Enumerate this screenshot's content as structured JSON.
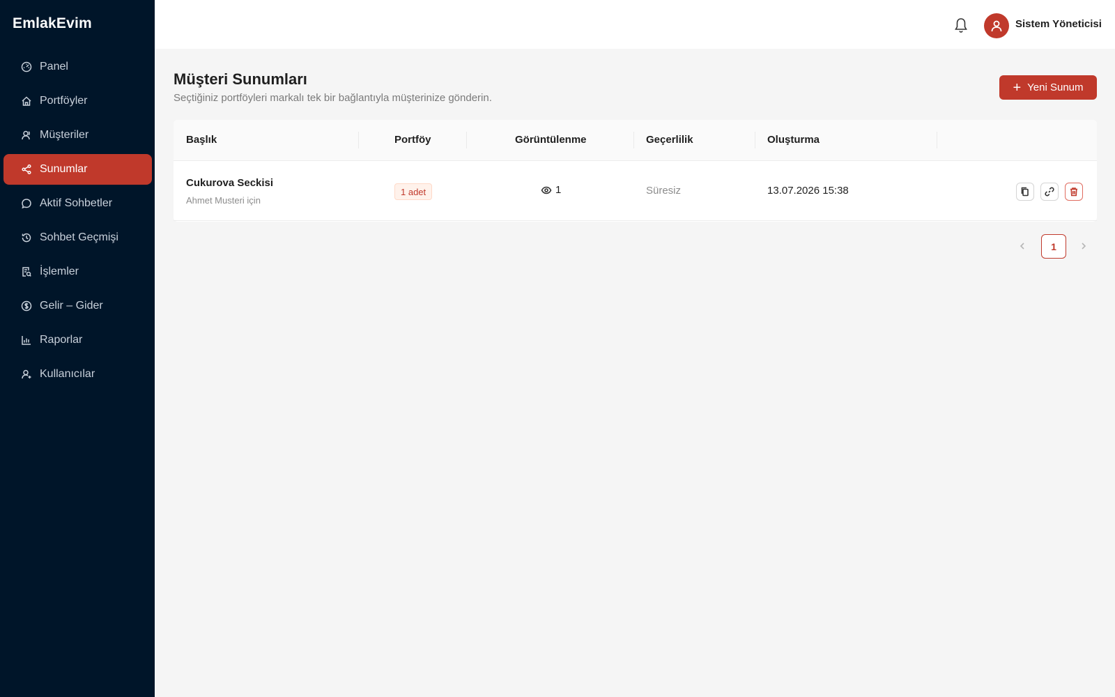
{
  "brand": "EmlakEvim",
  "sidebar": {
    "items": [
      {
        "label": "Panel",
        "icon": "dashboard-icon"
      },
      {
        "label": "Portföyler",
        "icon": "home-icon"
      },
      {
        "label": "Müşteriler",
        "icon": "users-icon"
      },
      {
        "label": "Sunumlar",
        "icon": "share-icon",
        "active": true
      },
      {
        "label": "Aktif Sohbetler",
        "icon": "chat-icon"
      },
      {
        "label": "Sohbet Geçmişi",
        "icon": "history-icon"
      },
      {
        "label": "İşlemler",
        "icon": "audit-icon"
      },
      {
        "label": "Gelir – Gider",
        "icon": "dollar-icon"
      },
      {
        "label": "Raporlar",
        "icon": "bar-chart-icon"
      },
      {
        "label": "Kullanıcılar",
        "icon": "user-add-icon"
      }
    ]
  },
  "header": {
    "user_name": "Sistem Yöneticisi"
  },
  "page": {
    "title": "Müşteri Sunumları",
    "subtitle": "Seçtiğiniz portföyleri markalı tek bir bağlantıyla müşterinize gönderin.",
    "new_button_label": "Yeni Sunum"
  },
  "table": {
    "columns": [
      "Başlık",
      "Portföy",
      "Görüntülenme",
      "Geçerlilik",
      "Oluşturma"
    ],
    "rows": [
      {
        "title": "Cukurova Seckisi",
        "subtitle": "Ahmet Musteri için",
        "portfolio": "1 adet",
        "views": "1",
        "validity": "Süresiz",
        "created": "13.07.2026 15:38"
      }
    ]
  },
  "pagination": {
    "current_page": "1"
  },
  "colors": {
    "sidebar_bg": "#001529",
    "accent": "#c0392b",
    "page_bg": "#f5f5f5"
  }
}
